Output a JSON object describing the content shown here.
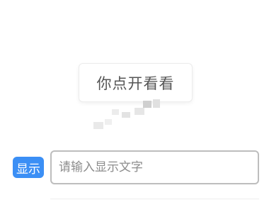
{
  "main_button": {
    "label": "你点开看看"
  },
  "show_button": {
    "label": "显示"
  },
  "display_input": {
    "placeholder": "请输入显示文字",
    "value": ""
  },
  "colors": {
    "accent": "#3b8ff5",
    "input_border": "#bdbdbd",
    "button_text": "#555555"
  }
}
